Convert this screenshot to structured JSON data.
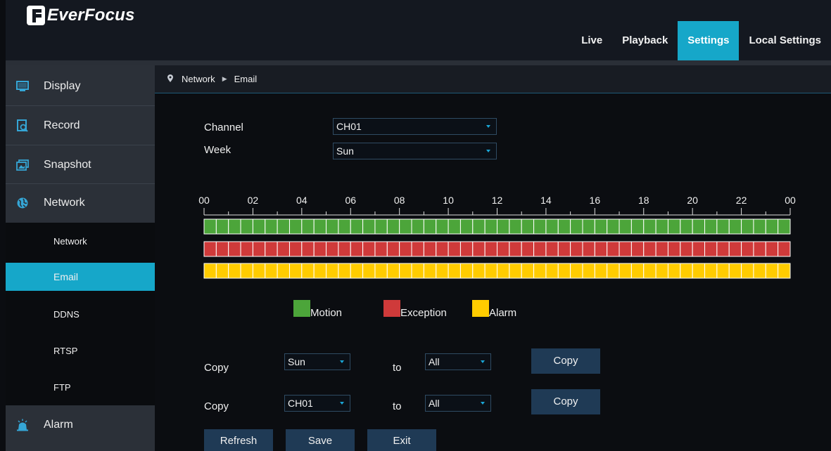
{
  "brand": {
    "name": "EverFocus"
  },
  "topnav": {
    "live": "Live",
    "playback": "Playback",
    "settings": "Settings",
    "local_settings": "Local Settings"
  },
  "sidebar": {
    "items": [
      {
        "label": "Display",
        "icon": "monitor-icon"
      },
      {
        "label": "Record",
        "icon": "record-icon"
      },
      {
        "label": "Snapshot",
        "icon": "snapshot-icon"
      },
      {
        "label": "Network",
        "icon": "network-globe-icon"
      },
      {
        "label": "Alarm",
        "icon": "alarm-bell-icon"
      }
    ],
    "network_sub": [
      "Network",
      "Email",
      "DDNS",
      "RTSP",
      "FTP"
    ],
    "active_sub": "Email"
  },
  "breadcrumb": {
    "parent": "Network",
    "current": "Email"
  },
  "form": {
    "channel_label": "Channel",
    "channel_value": "CH01",
    "week_label": "Week",
    "week_value": "Sun"
  },
  "schedule": {
    "hour_labels": [
      "00",
      "02",
      "04",
      "06",
      "08",
      "10",
      "12",
      "14",
      "16",
      "18",
      "20",
      "22",
      "00"
    ],
    "slots": 48,
    "rows": [
      {
        "name": "Motion",
        "color": "#4ca53a",
        "filled_slots": 48
      },
      {
        "name": "Exception",
        "color": "#cf3a3a",
        "filled_slots": 48
      },
      {
        "name": "Alarm",
        "color": "#ffcc00",
        "filled_slots": 48
      }
    ]
  },
  "legend": {
    "motion": "Motion",
    "exception": "Exception",
    "alarm": "Alarm",
    "motion_color": "#4ca53a",
    "exception_color": "#cf3a3a",
    "alarm_color": "#ffcc00"
  },
  "copy_rows": [
    {
      "label": "Copy",
      "from": "Sun",
      "to_label": "to",
      "to": "All",
      "button": "Copy"
    },
    {
      "label": "Copy",
      "from": "CH01",
      "to_label": "to",
      "to": "All",
      "button": "Copy"
    }
  ],
  "actions": {
    "refresh": "Refresh",
    "save": "Save",
    "exit": "Exit"
  },
  "colors": {
    "accent": "#16a7c9"
  }
}
